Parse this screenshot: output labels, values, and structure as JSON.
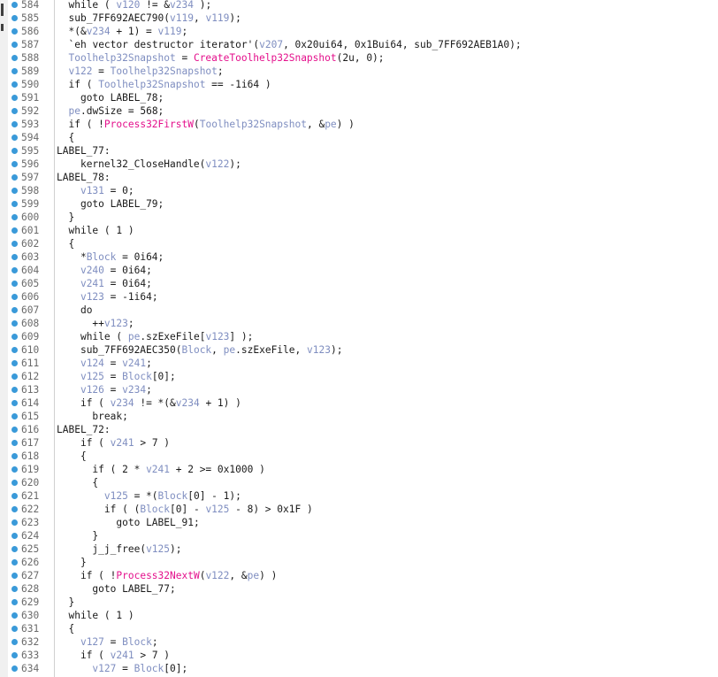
{
  "code_lines": [
    {
      "no": "584",
      "text": "  while ( v120 != &v234 );"
    },
    {
      "no": "585",
      "text": "  sub_7FF692AEC790(v119, v119);"
    },
    {
      "no": "586",
      "text": "  *(&v234 + 1) = v119;"
    },
    {
      "no": "587",
      "text": "  `eh vector destructor iterator'(v207, 0x20ui64, 0x1Bui64, sub_7FF692AEB1A0);"
    },
    {
      "no": "588",
      "text": "  Toolhelp32Snapshot = CreateToolhelp32Snapshot(2u, 0);"
    },
    {
      "no": "589",
      "text": "  v122 = Toolhelp32Snapshot;"
    },
    {
      "no": "590",
      "text": "  if ( Toolhelp32Snapshot == -1i64 )"
    },
    {
      "no": "591",
      "text": "    goto LABEL_78;"
    },
    {
      "no": "592",
      "text": "  pe.dwSize = 568;"
    },
    {
      "no": "593",
      "text": "  if ( !Process32FirstW(Toolhelp32Snapshot, &pe) )"
    },
    {
      "no": "594",
      "text": "  {"
    },
    {
      "no": "595",
      "text": "LABEL_77:"
    },
    {
      "no": "596",
      "text": "    kernel32_CloseHandle(v122);"
    },
    {
      "no": "597",
      "text": "LABEL_78:"
    },
    {
      "no": "598",
      "text": "    v131 = 0;"
    },
    {
      "no": "599",
      "text": "    goto LABEL_79;"
    },
    {
      "no": "600",
      "text": "  }"
    },
    {
      "no": "601",
      "text": "  while ( 1 )"
    },
    {
      "no": "602",
      "text": "  {"
    },
    {
      "no": "603",
      "text": "    *Block = 0i64;"
    },
    {
      "no": "604",
      "text": "    v240 = 0i64;"
    },
    {
      "no": "605",
      "text": "    v241 = 0i64;"
    },
    {
      "no": "606",
      "text": "    v123 = -1i64;"
    },
    {
      "no": "607",
      "text": "    do"
    },
    {
      "no": "608",
      "text": "      ++v123;"
    },
    {
      "no": "609",
      "text": "    while ( pe.szExeFile[v123] );"
    },
    {
      "no": "610",
      "text": "    sub_7FF692AEC350(Block, pe.szExeFile, v123);"
    },
    {
      "no": "611",
      "text": "    v124 = v241;"
    },
    {
      "no": "612",
      "text": "    v125 = Block[0];"
    },
    {
      "no": "613",
      "text": "    v126 = v234;"
    },
    {
      "no": "614",
      "text": "    if ( v234 != *(&v234 + 1) )"
    },
    {
      "no": "615",
      "text": "      break;"
    },
    {
      "no": "616",
      "text": "LABEL_72:"
    },
    {
      "no": "617",
      "text": "    if ( v241 > 7 )"
    },
    {
      "no": "618",
      "text": "    {"
    },
    {
      "no": "619",
      "text": "      if ( 2 * v241 + 2 >= 0x1000 )"
    },
    {
      "no": "620",
      "text": "      {"
    },
    {
      "no": "621",
      "text": "        v125 = *(Block[0] - 1);"
    },
    {
      "no": "622",
      "text": "        if ( (Block[0] - v125 - 8) > 0x1F )"
    },
    {
      "no": "623",
      "text": "          goto LABEL_91;"
    },
    {
      "no": "624",
      "text": "      }"
    },
    {
      "no": "625",
      "text": "      j_j_free(v125);"
    },
    {
      "no": "626",
      "text": "    }"
    },
    {
      "no": "627",
      "text": "    if ( !Process32NextW(v122, &pe) )"
    },
    {
      "no": "628",
      "text": "      goto LABEL_77;"
    },
    {
      "no": "629",
      "text": "  }"
    },
    {
      "no": "630",
      "text": "  while ( 1 )"
    },
    {
      "no": "631",
      "text": "  {"
    },
    {
      "no": "632",
      "text": "    v127 = Block;"
    },
    {
      "no": "633",
      "text": "    if ( v241 > 7 )"
    },
    {
      "no": "634",
      "text": "      v127 = Block[0];"
    }
  ],
  "tokens": {
    "variables": [
      "v119",
      "v120",
      "v122",
      "v123",
      "v124",
      "v125",
      "v126",
      "v127",
      "v131",
      "v207",
      "v234",
      "v240",
      "v241",
      "Toolhelp32Snapshot",
      "Block",
      "pe"
    ],
    "imports": [
      "CreateToolhelp32Snapshot",
      "Process32FirstW",
      "Process32NextW"
    ]
  },
  "colors": {
    "variable": "#7f8ec0",
    "import": "#e4108c",
    "text": "#1a1a1a",
    "line_number": "#6a6a6a",
    "breakpoint_dot": "#3a9ad9",
    "gutter_border": "#d0d0d0"
  }
}
